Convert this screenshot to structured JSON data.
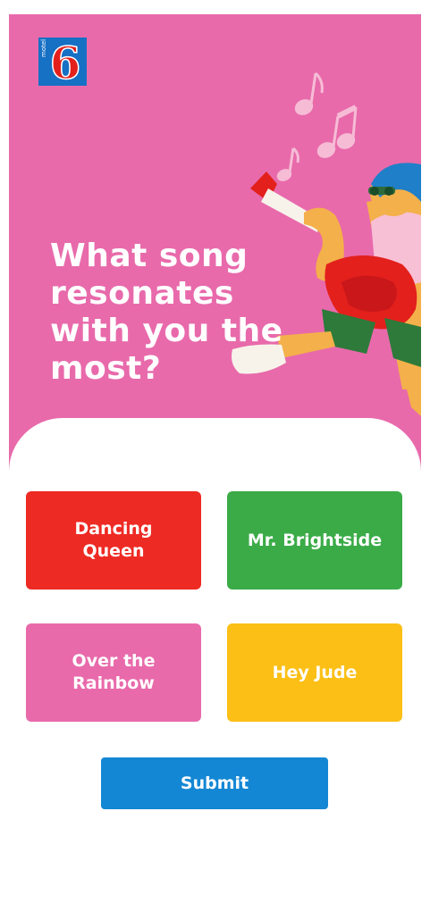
{
  "brand": {
    "logo_name": "motel-6-logo",
    "logo_word": "motel",
    "logo_number": "6"
  },
  "hero": {
    "question": "What song resonates with you the most?"
  },
  "options": [
    {
      "label": "Dancing Queen",
      "color": "#ee2a24"
    },
    {
      "label": "Mr. Brightside",
      "color": "#3bab48"
    },
    {
      "label": "Over the Rainbow",
      "color": "#e86aab"
    },
    {
      "label": "Hey Jude",
      "color": "#fbbf16"
    }
  ],
  "submit": {
    "label": "Submit",
    "color": "#1487d4"
  },
  "colors": {
    "hero_bg": "#e86aab",
    "panel_bg": "#ffffff"
  }
}
